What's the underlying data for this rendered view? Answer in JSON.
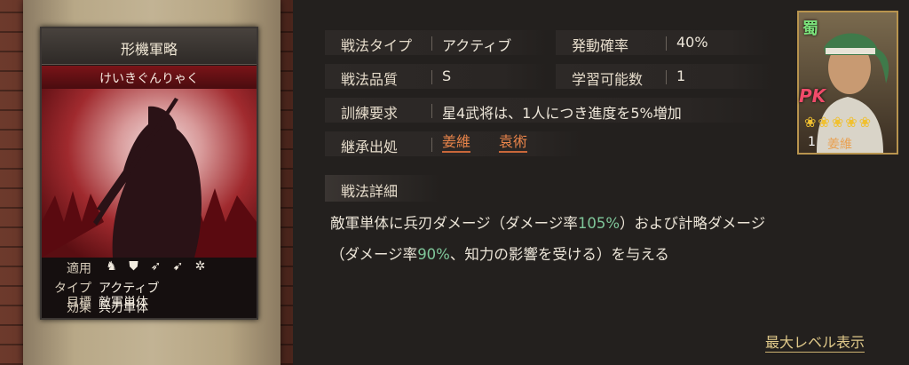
{
  "card": {
    "title": "形機軍略",
    "reading": "けいきぐんりゃく",
    "stats": [
      {
        "key": "適用",
        "value": ""
      },
      {
        "key": "タイプ",
        "value": "アクティブ"
      },
      {
        "key": "効果",
        "value": "兵刃単体"
      },
      {
        "key": "目標",
        "value": "敵軍単体"
      }
    ],
    "apply_icons": [
      "cavalry-icon",
      "shield-icon",
      "archer-icon",
      "spear-icon",
      "siege-icon"
    ]
  },
  "info": {
    "type_label": "戦法タイプ",
    "type_value": "アクティブ",
    "rate_label": "発動確率",
    "rate_value": "40%",
    "quality_label": "戦法品質",
    "quality_value": "S",
    "learn_label": "学習可能数",
    "learn_value": "1",
    "train_label": "訓練要求",
    "train_value": "星4武将は、1人につき進度を5%増加",
    "source_label": "継承出処",
    "sources": [
      "姜維",
      "袁術"
    ]
  },
  "details": {
    "heading": "戦法詳細",
    "line1_a": "敵軍単体に兵刃ダメージ（ダメージ率",
    "line1_b": "105%",
    "line1_c": "）および計略ダメージ",
    "line2_a": "（ダメージ率",
    "line2_b": "90%",
    "line2_c": "、知力の影響を受ける）を与える"
  },
  "footer": {
    "max_level": "最大レベル表示"
  },
  "portrait": {
    "faction": "蜀",
    "badge": "PK",
    "stars": "❀❀❀❀❀",
    "level": "1",
    "name": "姜維"
  },
  "colors": {
    "accent_orange": "#e9844a",
    "highlight_green": "#7fc79a",
    "gold": "#e0c98a"
  }
}
